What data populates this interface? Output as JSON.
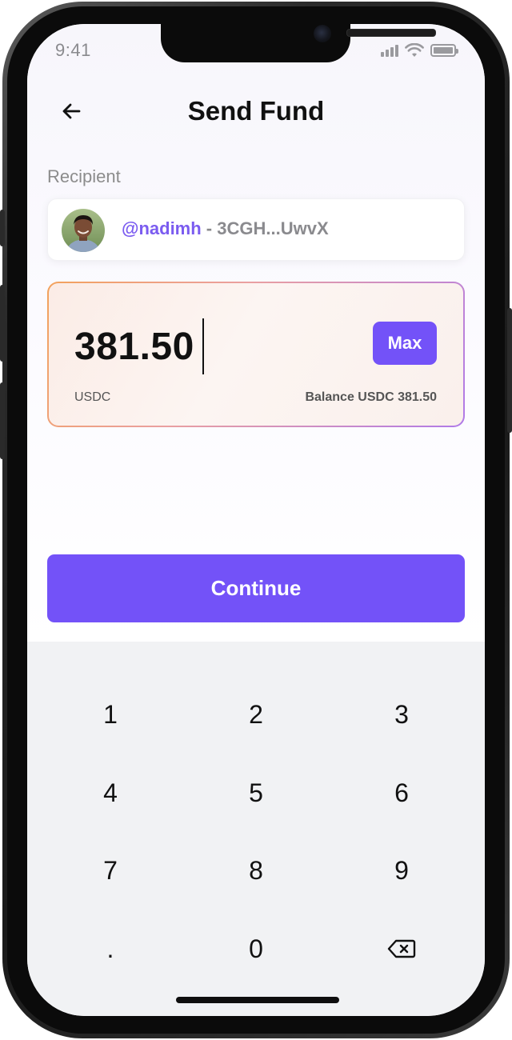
{
  "status_bar": {
    "time": "9:41"
  },
  "header": {
    "title": "Send Fund"
  },
  "recipient": {
    "label": "Recipient",
    "handle": "@nadimh",
    "separator": " - ",
    "address": "3CGH...UwvX"
  },
  "amount": {
    "value": "381.50",
    "max_label": "Max",
    "currency": "USDC",
    "balance": "Balance USDC 381.50"
  },
  "continue_label": "Continue",
  "keypad": {
    "keys": [
      "1",
      "2",
      "3",
      "4",
      "5",
      "6",
      "7",
      "8",
      "9",
      ".",
      "0"
    ]
  },
  "colors": {
    "accent": "#7352f8",
    "handle": "#7b5cf0",
    "keypad_bg": "#f1f2f4"
  }
}
